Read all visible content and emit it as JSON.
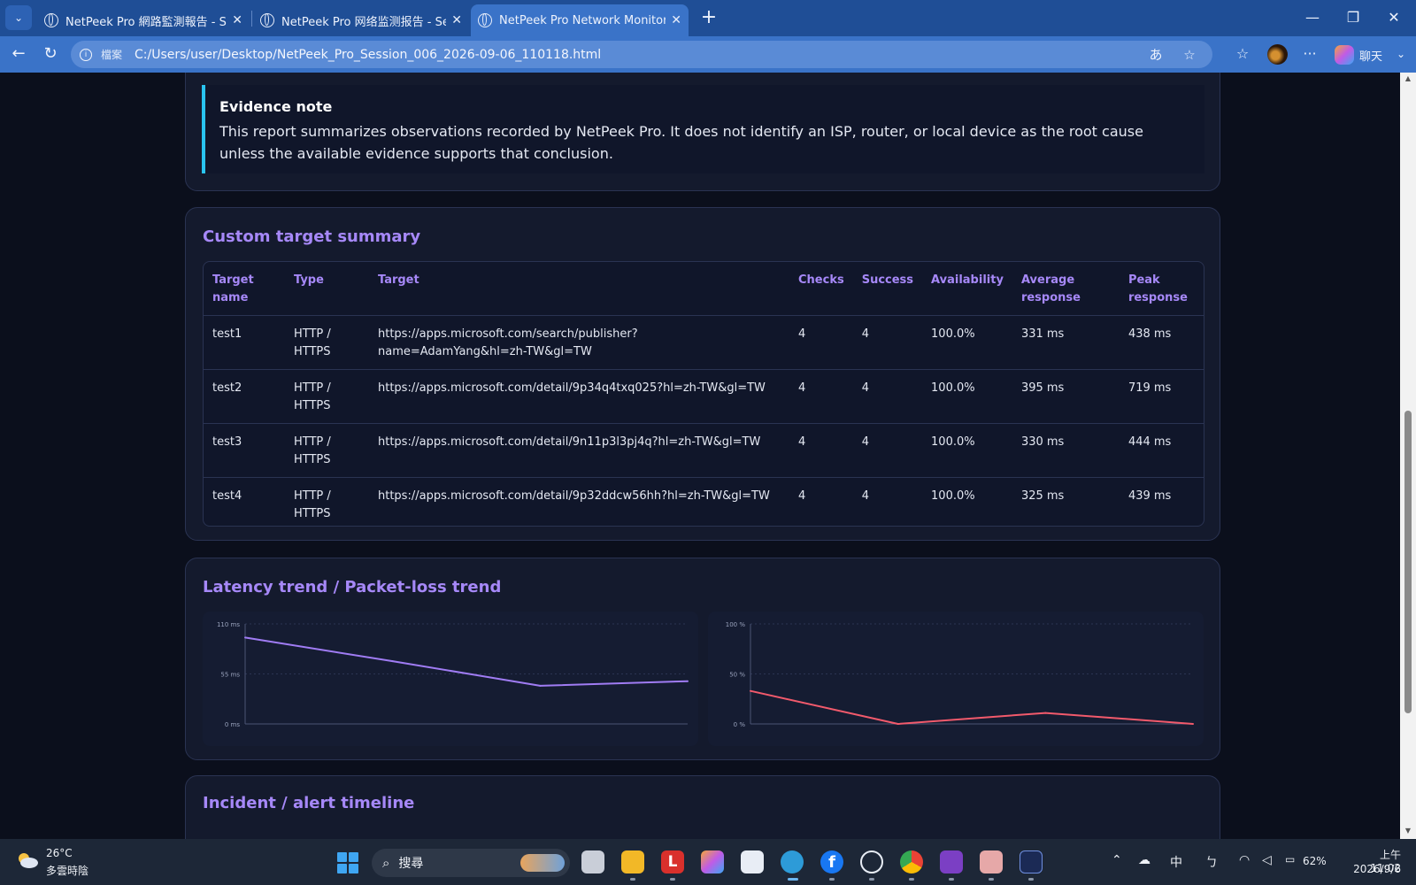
{
  "browser": {
    "tabs": [
      {
        "title": "NetPeek Pro 網路監測報告 - Session 006",
        "active": false
      },
      {
        "title": "NetPeek Pro 网络监测报告 - Session 006",
        "active": false
      },
      {
        "title": "NetPeek Pro Network Monitoring Report",
        "active": true
      }
    ],
    "address": {
      "file_label": "檔案",
      "url": "C:/Users/user/Desktop/NetPeek_Pro_Session_006_2026-09-06_110118.html"
    },
    "chat_label": "聊天"
  },
  "evidence": {
    "title": "Evidence note",
    "text": "This report summarizes observations recorded by NetPeek Pro. It does not identify an ISP, router, or local device as the root cause unless the available evidence supports that conclusion."
  },
  "custom_targets": {
    "heading": "Custom target summary",
    "columns": [
      "Target name",
      "Type",
      "Target",
      "Checks",
      "Success",
      "Availability",
      "Average response",
      "Peak response"
    ],
    "rows": [
      {
        "name": "test1",
        "type": "HTTP / HTTPS",
        "target": "https://apps.microsoft.com/search/publisher?name=AdamYang&hl=zh-TW&gl=TW",
        "checks": "4",
        "success": "4",
        "availability": "100.0%",
        "avg": "331 ms",
        "peak": "438 ms"
      },
      {
        "name": "test2",
        "type": "HTTP / HTTPS",
        "target": "https://apps.microsoft.com/detail/9p34q4txq025?hl=zh-TW&gl=TW",
        "checks": "4",
        "success": "4",
        "availability": "100.0%",
        "avg": "395 ms",
        "peak": "719 ms"
      },
      {
        "name": "test3",
        "type": "HTTP / HTTPS",
        "target": "https://apps.microsoft.com/detail/9n11p3l3pj4q?hl=zh-TW&gl=TW",
        "checks": "4",
        "success": "4",
        "availability": "100.0%",
        "avg": "330 ms",
        "peak": "444 ms"
      },
      {
        "name": "test4",
        "type": "HTTP / HTTPS",
        "target": "https://apps.microsoft.com/detail/9p32ddcw56hh?hl=zh-TW&gl=TW",
        "checks": "4",
        "success": "4",
        "availability": "100.0%",
        "avg": "325 ms",
        "peak": "439 ms"
      }
    ]
  },
  "trends": {
    "heading": "Latency trend / Packet-loss trend"
  },
  "chart_data": [
    {
      "type": "line",
      "title": "",
      "x": [
        1,
        2,
        3,
        4
      ],
      "series": [
        {
          "values": [
            95,
            69,
            42,
            47
          ],
          "color": "#a07cf4"
        }
      ],
      "ylim": [
        0,
        110
      ],
      "y_ticks": [
        "0 ms",
        "55 ms",
        "110 ms"
      ],
      "grid": true
    },
    {
      "type": "line",
      "title": "",
      "x": [
        1,
        2,
        3,
        4,
        5
      ],
      "series": [
        {
          "values": [
            33,
            0,
            11,
            0
          ],
          "color": "#f25a6c"
        }
      ],
      "ylim": [
        0,
        100
      ],
      "y_ticks": [
        "0 %",
        "50 %",
        "100 %"
      ],
      "grid": true
    }
  ],
  "incidents": {
    "heading": "Incident / alert timeline"
  },
  "taskbar": {
    "weather_temp": "26°C",
    "weather_desc": "多雲時陰",
    "search_placeholder": "搜尋",
    "ime": "中",
    "battery": "62%",
    "time": "上午 11:02",
    "date": "2026/9/6"
  },
  "colors": {
    "accent": "#a688f8",
    "latency_line": "#a07cf4",
    "loss_line": "#f25a6c",
    "evidence_bar": "#29c4f0"
  }
}
